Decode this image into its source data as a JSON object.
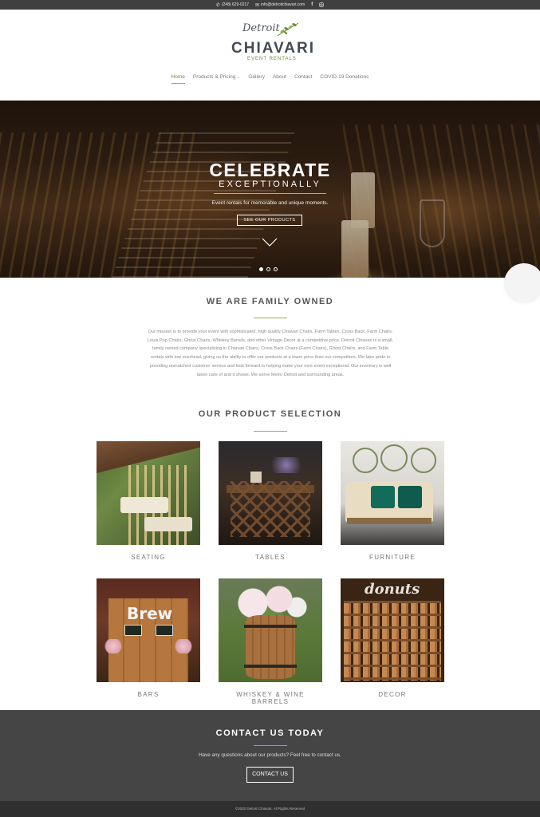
{
  "topbar": {
    "phone": "(248) 629-0217",
    "email": "info@detroitchiavari.com",
    "facebook_icon": "facebook-icon",
    "instagram_icon": "instagram-icon"
  },
  "logo": {
    "script": "Detroit",
    "main": "CHIAVARI",
    "sub": "EVENT RENTALS"
  },
  "nav": {
    "items": [
      {
        "label": "Home"
      },
      {
        "label": "Products & Pricing"
      },
      {
        "label": "Gallery"
      },
      {
        "label": "About"
      },
      {
        "label": "Contact"
      },
      {
        "label": "COVID-19 Donations"
      }
    ],
    "dropdown_icon": "chevron-down-icon"
  },
  "hero": {
    "title": "CELEBRATE",
    "subtitle": "EXCEPTIONALLY",
    "description": "Event rentals for memorable and unique moments.",
    "button": "SEE OUR PRODUCTS",
    "slides": 3,
    "active_slide": 1
  },
  "family": {
    "title": "WE ARE FAMILY OWNED",
    "text": "Our mission is to provide your event with sophisticated, high quality Chiavari Chairs, Farm Tables, Cross Back, Farm Chairs, Louis Pop Chairs, Ghost Chairs, Whiskey Barrels, and other Vintage Decor at a competitive price. Detroit Chiavari is a small, family owned company specializing in Chiavari Chairs, Cross Back Chairs (Farm Chairs), Ghost Chairs, and Farm Table rentals with low overhead, giving us the ability to offer our products at a lower price than our competitors. We take pride in providing unmatched customer service and look forward to helping make your next event exceptional. Our inventory is well taken care of and it shows. We serve Metro Detroit and surrounding areas."
  },
  "products": {
    "title": "OUR PRODUCT SELECTION",
    "items": [
      {
        "label": "SEATING"
      },
      {
        "label": "TABLES"
      },
      {
        "label": "FURNITURE"
      },
      {
        "label": "BARS",
        "sign": "Brew"
      },
      {
        "label": "WHISKEY & WINE BARRELS"
      },
      {
        "label": "DECOR",
        "sign": "donuts"
      }
    ]
  },
  "contact": {
    "title": "CONTACT US TODAY",
    "text": "Have any questions about our products? Feel free to contact us.",
    "button": "CONTACT US"
  },
  "footer": {
    "text": "©2020 Detroit Chiavari. All Rights Reserved"
  },
  "colors": {
    "accent": "#8fb24a",
    "topbar": "#3f3f3f",
    "contact_bg": "#454545",
    "footer_bg": "#2f2f2f"
  }
}
